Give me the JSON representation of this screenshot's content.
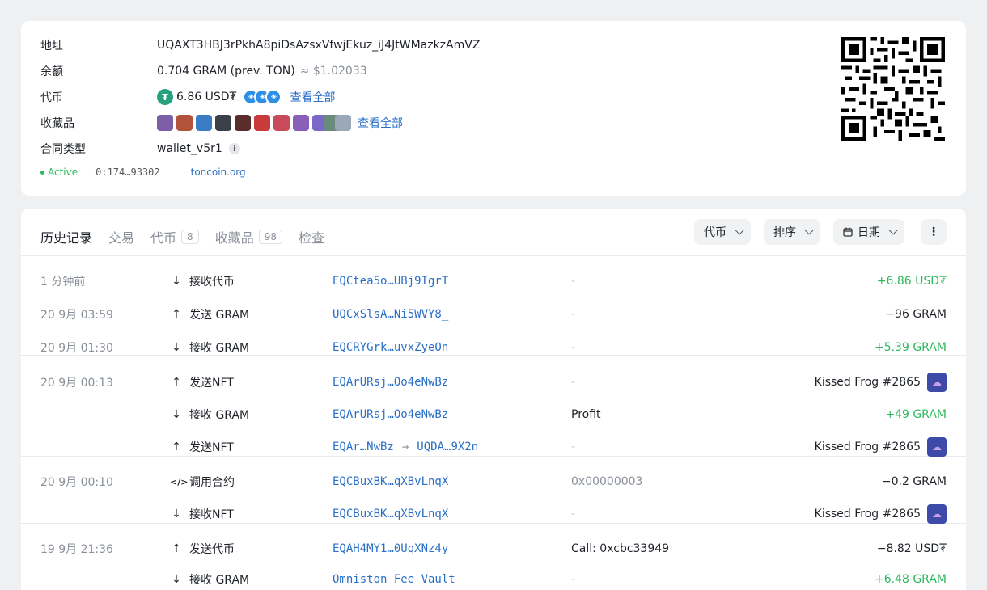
{
  "account": {
    "address_label": "地址",
    "address": "UQAXT3HBJ3rPkhA8piDsAzsxVfwjEkuz_iJ4JtWMazkzAmVZ",
    "balance_label": "余额",
    "balance": "0.704 GRAM (prev. TON)",
    "balance_fiat": "≈ $1.02033",
    "tokens_label": "代币",
    "tokens_amount": "6.86 USD₮",
    "tokens_view_all": "查看全部",
    "collectibles_label": "收藏品",
    "collectibles_view_all": "查看全部",
    "contract_label": "合同类型",
    "contract_type": "wallet_v5r1",
    "status": "Active",
    "workchain_id": "0:174…93302",
    "domain": "toncoin.org"
  },
  "tabs": [
    {
      "label": "历史记录"
    },
    {
      "label": "交易"
    },
    {
      "label": "代币",
      "count": "8"
    },
    {
      "label": "收藏品",
      "count": "98"
    },
    {
      "label": "检查"
    }
  ],
  "filters": {
    "token": "代币",
    "sort": "排序",
    "date": "日期"
  },
  "transactions": [
    {
      "time": "1 分钟前",
      "dir": "in",
      "type": "接收代币",
      "addr": "EQCtea5o…UBj9IgrT",
      "comment": "-",
      "amount": "+6.86 USD₮",
      "sign": "pos"
    },
    {
      "time": "20 9月 03:59",
      "dir": "out",
      "type": "发送 GRAM",
      "addr": "UQCxSlsA…Ni5WVY8_",
      "comment": "-",
      "amount": "−96 GRAM",
      "sign": "neg"
    },
    {
      "time": "20 9月 01:30",
      "dir": "in",
      "type": "接收 GRAM",
      "addr": "EQCRYGrk…uvxZyeOn",
      "comment": "-",
      "amount": "+5.39 GRAM",
      "sign": "pos"
    },
    {
      "time": "20 9月 00:13",
      "dir": "out",
      "type": "发送NFT",
      "addr": "EQArURsj…Oo4eNwBz",
      "comment": "-",
      "amount": "Kissed Frog #2865",
      "sign": "neg"
    },
    {
      "time": "",
      "dir": "in",
      "type": "接收 GRAM",
      "addr": "EQArURsj…Oo4eNwBz",
      "comment": "Profit",
      "amount": "+49 GRAM",
      "sign": "pos"
    },
    {
      "time": "",
      "dir": "out",
      "type": "发送NFT",
      "addr": "EQAr…NwBz",
      "addr2": "UQDA…9X2n",
      "comment": "-",
      "amount": "Kissed Frog #2865",
      "sign": "neg"
    },
    {
      "time": "20 9月 00:10",
      "dir": "code",
      "type": "调用合约",
      "addr": "EQCBuxBK…qXBvLnqX",
      "comment": "0x00000003",
      "amount": "−0.2 GRAM",
      "sign": "neg"
    },
    {
      "time": "",
      "dir": "in",
      "type": "接收NFT",
      "addr": "EQCBuxBK…qXBvLnqX",
      "comment": "-",
      "amount": "Kissed Frog #2865",
      "sign": "neg"
    },
    {
      "time": "19 9月 21:36",
      "dir": "out",
      "type": "发送代币",
      "addr": "EQAH4MY1…0UqXNz4y",
      "comment": "Call: 0xcbc33949",
      "amount": "−8.82 USD₮",
      "sign": "neg"
    },
    {
      "time": "",
      "dir": "in",
      "type": "接收 GRAM",
      "addr": "Omniston Fee Vault",
      "comment": "-",
      "amount": "+6.48 GRAM",
      "sign": "pos"
    }
  ],
  "colors": {
    "accent": "#2a6fc8",
    "positive": "#2eb85c",
    "usdt": "#26a17b"
  }
}
